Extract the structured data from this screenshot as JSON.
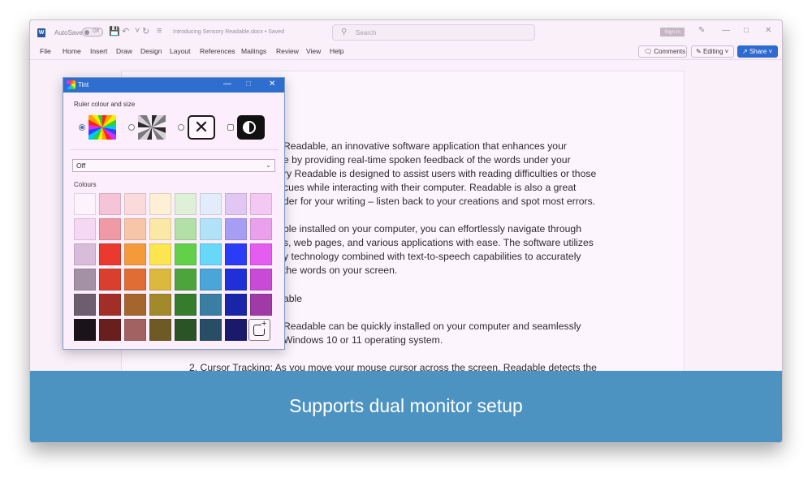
{
  "titlebar": {
    "autosave_label": "AutoSave",
    "autosave_state": "Off",
    "document_title": "Introducing Sensory Readable.docx • Saved",
    "search_placeholder": "Search",
    "signin_label": "Sign in"
  },
  "menu": {
    "items": [
      "File",
      "Home",
      "Insert",
      "Draw",
      "Design",
      "Layout",
      "References",
      "Mailings",
      "Review",
      "View",
      "Help"
    ],
    "comments_label": "Comments",
    "editing_label": "Editing",
    "share_label": "Share"
  },
  "document": {
    "lines": [
      "Readable, an innovative software application that enhances your",
      "e by providing real-time spoken feedback of the words under your",
      "ry Readable is designed to assist users with reading difficulties or those",
      "cues while interacting with their computer. Readable is also a great",
      "der for your writing – listen back to your creations and spot most errors.",
      "ble installed on your computer, you can effortlessly navigate through",
      "s, web pages, and various applications with ease. The software utilizes",
      "y technology combined with text-to-speech capabilities to accurately",
      "the words on your screen.",
      "able",
      "Readable can be quickly installed on your computer and seamlessly",
      "Windows 10 or 11 operating system.",
      "2. Cursor Tracking: As you move your mouse cursor across the screen, Readable detects the"
    ]
  },
  "dialog": {
    "title": "Tint",
    "ruler_label": "Ruler colour and size",
    "options": [
      {
        "icon": "rainbow-ruler-icon",
        "selected": true
      },
      {
        "icon": "swirl-ruler-icon",
        "selected": false
      },
      {
        "icon": "no-ruler-icon",
        "selected": false
      },
      {
        "icon": "contrast-icon",
        "selected": false
      }
    ],
    "dropdown_value": "Off",
    "colours_label": "Colours",
    "swatches": [
      [
        "#fdf3fd",
        "#f6c4d8",
        "#fadadb",
        "#fdf0d6",
        "#def0d8",
        "#e2ecfa",
        "#e2c7f5",
        "#f3c8f3"
      ],
      [
        "#f4d8f4",
        "#ef9aa4",
        "#f7c6a8",
        "#fbe7a6",
        "#b2e0a6",
        "#b2e2f8",
        "#a69ef5",
        "#eba0ee"
      ],
      [
        "#d9bcd9",
        "#ea3a30",
        "#f59a3a",
        "#fbe650",
        "#63d04a",
        "#68d8f8",
        "#2a3cf5",
        "#e45cf0"
      ],
      [
        "#a591a5",
        "#d9402c",
        "#df6d34",
        "#dbb93c",
        "#4da43c",
        "#4aa6d8",
        "#2030d8",
        "#c84ad6"
      ],
      [
        "#6e5d6e",
        "#a32e28",
        "#a5652e",
        "#a28a2a",
        "#357d2c",
        "#3a7ea4",
        "#1a24a8",
        "#a03aa6"
      ],
      [
        "#1a141a",
        "#6a1e1e",
        "#a26262",
        "#6e5a24",
        "#2a5426",
        "#284e66",
        "#1a1a6a",
        null
      ]
    ]
  },
  "caption": {
    "text": "Supports dual monitor setup"
  }
}
